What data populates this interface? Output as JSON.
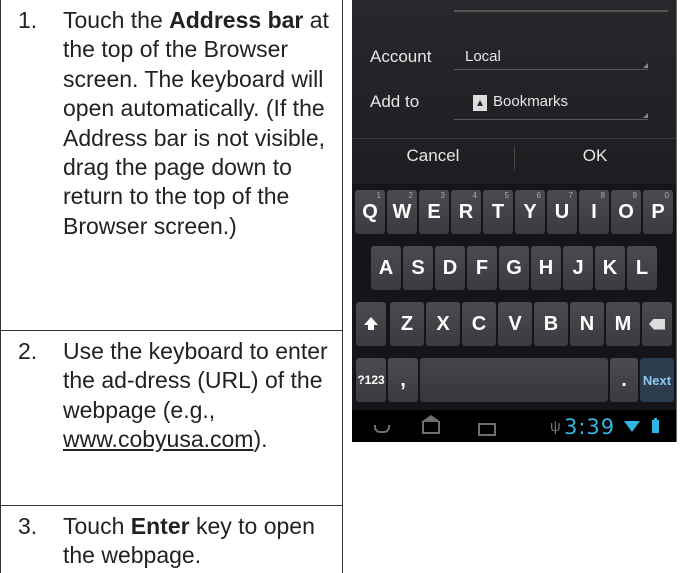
{
  "steps": [
    {
      "number": "1.",
      "pre": "Touch the ",
      "bold": "Address bar",
      "post": " at the top of the Browser screen. The keyboard will open automatically. (If the Address bar is not visible, drag the page down to return to the top of the Browser screen.)"
    },
    {
      "number": "2.",
      "pre": "Use the keyboard to enter the ad-dress (URL) of the webpage (e.g., ",
      "link": "www.cobyusa.com",
      "post": ")."
    },
    {
      "number": "3.",
      "pre": "Touch ",
      "bold": "Enter",
      "post": " key to open the webpage."
    }
  ],
  "phone": {
    "dialog": {
      "account_label": "Account",
      "account_value": "Local",
      "add_to_label": "Add to",
      "add_to_value": "Bookmarks",
      "cancel_label": "Cancel",
      "ok_label": "OK"
    },
    "keyboard": {
      "row1": [
        {
          "k": "Q",
          "s": "1"
        },
        {
          "k": "W",
          "s": "2"
        },
        {
          "k": "E",
          "s": "3"
        },
        {
          "k": "R",
          "s": "4"
        },
        {
          "k": "T",
          "s": "5"
        },
        {
          "k": "Y",
          "s": "6"
        },
        {
          "k": "U",
          "s": "7"
        },
        {
          "k": "I",
          "s": "8"
        },
        {
          "k": "O",
          "s": "9"
        },
        {
          "k": "P",
          "s": "0"
        }
      ],
      "row2": [
        "A",
        "S",
        "D",
        "F",
        "G",
        "H",
        "J",
        "K",
        "L"
      ],
      "row3": [
        "Z",
        "X",
        "C",
        "V",
        "B",
        "N",
        "M"
      ],
      "symbols_label": "?123",
      "comma_label": ",",
      "period_label": ".",
      "next_label": "Next"
    },
    "status": {
      "time": "3:39",
      "accent_color": "#33b5e5"
    },
    "icons": [
      "bookmark-icon",
      "shift-icon",
      "backspace-icon",
      "back-icon",
      "home-icon",
      "recent-apps-icon",
      "usb-icon",
      "wifi-icon",
      "battery-icon"
    ]
  }
}
